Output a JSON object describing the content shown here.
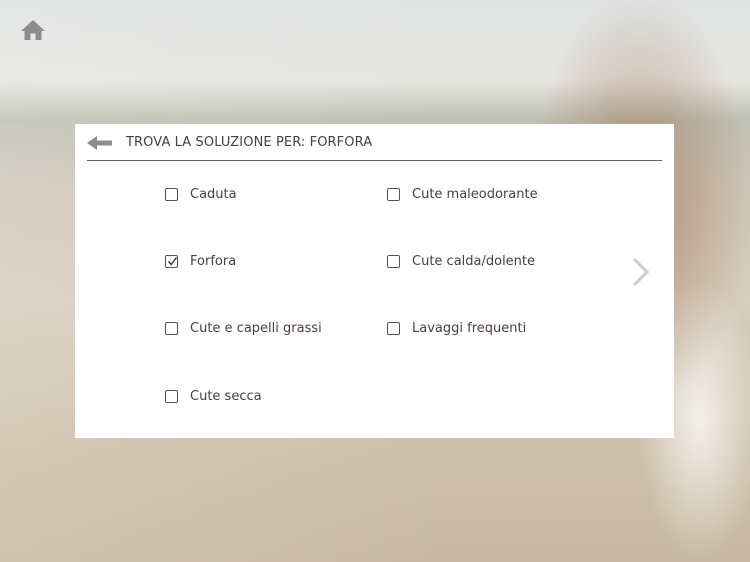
{
  "header": {
    "title": "TROVA LA SOLUZIONE PER: FORFORA"
  },
  "icons": {
    "home": "home-icon",
    "back": "arrow-left-icon",
    "next": "chevron-right-icon"
  },
  "colors": {
    "panel_bg": "#ffffff",
    "text": "#4a3f3a",
    "icon_gray": "#8c8c8c",
    "chevron": "#cfcfcf"
  },
  "options": [
    {
      "label": "Caduta",
      "checked": false
    },
    {
      "label": "Cute maleodorante",
      "checked": false
    },
    {
      "label": "Forfora",
      "checked": true
    },
    {
      "label": "Cute calda/dolente",
      "checked": false
    },
    {
      "label": "Cute e capelli grassi",
      "checked": false
    },
    {
      "label": "Lavaggi frequenti",
      "checked": false
    },
    {
      "label": "Cute secca",
      "checked": false
    }
  ]
}
